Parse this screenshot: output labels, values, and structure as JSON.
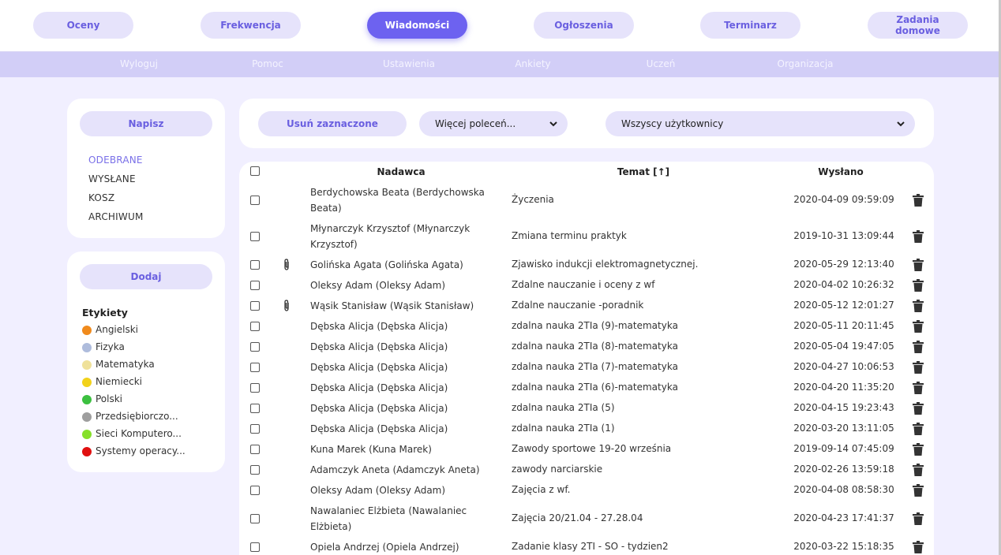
{
  "nav": {
    "top": [
      "Oceny",
      "Frekwencja",
      "Wiadomości",
      "Ogłoszenia",
      "Terminarz",
      "Zadania domowe"
    ],
    "active": "Wiadomości",
    "sub": [
      "Wyloguj",
      "Pomoc",
      "Ustawienia",
      "Ankiety",
      "Uczeń",
      "Organizacja"
    ]
  },
  "sidebar": {
    "compose_label": "Napisz",
    "folders": [
      "ODEBRANE",
      "WYSŁANE",
      "KOSZ",
      "ARCHIWUM"
    ],
    "active_folder": "ODEBRANE",
    "add_label": "Dodaj",
    "labels_title": "Etykiety",
    "labels": [
      {
        "name": "Angielski",
        "color": "#f08a1c"
      },
      {
        "name": "Fizyka",
        "color": "#aebcdc"
      },
      {
        "name": "Matematyka",
        "color": "#efe19a"
      },
      {
        "name": "Niemiecki",
        "color": "#f2d21a"
      },
      {
        "name": "Polski",
        "color": "#3cc040"
      },
      {
        "name": "Przedsiębiorczo...",
        "color": "#9e9e9e"
      },
      {
        "name": "Sieci Komputero...",
        "color": "#86e02a"
      },
      {
        "name": "Systemy operacy...",
        "color": "#e01010"
      }
    ]
  },
  "toolbar": {
    "delete_label": "Usuń zaznaczone",
    "more_actions": "Więcej poleceń...",
    "users_filter": "Wszyscy użytkownicy"
  },
  "table": {
    "headers": {
      "sender": "Nadawca",
      "subject": "Temat [↑]",
      "sent": "Wysłano"
    },
    "rows": [
      {
        "sender": "Berdychowska Beata (Berdychowska Beata)",
        "subject": "Życzenia",
        "sent": "2020-04-09 09:59:09",
        "attachment": false
      },
      {
        "sender": "Młynarczyk Krzysztof (Młynarczyk Krzysztof)",
        "subject": "Zmiana terminu praktyk",
        "sent": "2019-10-31 13:09:44",
        "attachment": false
      },
      {
        "sender": "Golińska Agata (Golińska Agata)",
        "subject": "Zjawisko indukcji elektromagnetycznej.",
        "sent": "2020-05-29 12:13:40",
        "attachment": true
      },
      {
        "sender": "Oleksy Adam (Oleksy Adam)",
        "subject": "Zdalne nauczanie i oceny z wf",
        "sent": "2020-04-02 10:26:32",
        "attachment": false
      },
      {
        "sender": "Wąsik Stanisław (Wąsik Stanisław)",
        "subject": "Zdalne nauczanie -poradnik",
        "sent": "2020-05-12 12:01:27",
        "attachment": true
      },
      {
        "sender": "Dębska Alicja (Dębska Alicja)",
        "subject": "zdalna nauka 2TIa (9)-matematyka",
        "sent": "2020-05-11 20:11:45",
        "attachment": false
      },
      {
        "sender": "Dębska Alicja (Dębska Alicja)",
        "subject": "zdalna nauka 2TIa (8)-matematyka",
        "sent": "2020-05-04 19:47:05",
        "attachment": false
      },
      {
        "sender": "Dębska Alicja (Dębska Alicja)",
        "subject": "zdalna nauka 2TIa (7)-matematyka",
        "sent": "2020-04-27 10:06:53",
        "attachment": false
      },
      {
        "sender": "Dębska Alicja (Dębska Alicja)",
        "subject": "zdalna nauka 2TIa (6)-matematyka",
        "sent": "2020-04-20 11:35:20",
        "attachment": false
      },
      {
        "sender": "Dębska Alicja (Dębska Alicja)",
        "subject": "zdalna nauka 2TIa (5)",
        "sent": "2020-04-15 19:23:43",
        "attachment": false
      },
      {
        "sender": "Dębska Alicja (Dębska Alicja)",
        "subject": "zdalna nauka 2TIa (1)",
        "sent": "2020-03-20 13:11:05",
        "attachment": false
      },
      {
        "sender": "Kuna Marek (Kuna Marek)",
        "subject": "Zawody sportowe 19-20 września",
        "sent": "2019-09-14 07:45:09",
        "attachment": false
      },
      {
        "sender": "Adamczyk Aneta (Adamczyk Aneta)",
        "subject": "zawody narciarskie",
        "sent": "2020-02-26 13:59:18",
        "attachment": false
      },
      {
        "sender": "Oleksy Adam (Oleksy Adam)",
        "subject": "Zajęcia z wf.",
        "sent": "2020-04-08 08:58:30",
        "attachment": false
      },
      {
        "sender": "Nawalaniec Elżbieta (Nawalaniec Elżbieta)",
        "subject": "Zajęcia 20/21.04 - 27.28.04",
        "sent": "2020-04-23 17:41:37",
        "attachment": false
      },
      {
        "sender": "Opiela Andrzej (Opiela Andrzej)",
        "subject": "Zadanie klasy 2TI - SO - tydzien2",
        "sent": "2020-03-22 15:18:35",
        "attachment": false
      }
    ]
  }
}
